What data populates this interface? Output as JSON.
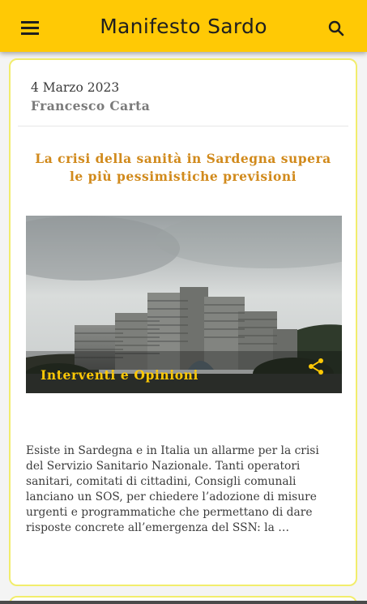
{
  "app_bar": {
    "title": "Manifesto Sardo",
    "menu_icon": "menu-icon",
    "search_icon": "search-icon",
    "background": "#ffc905"
  },
  "article": {
    "date": "4 Marzo 2023",
    "author": "Francesco Carta",
    "title": "La crisi della sanità in Sardegna supera le più pessimistiche previsioni",
    "category": "Interventi e Opinioni",
    "share_icon": "share-icon",
    "excerpt": "Esiste in Sardegna e in Italia un allarme per la crisi del Servizio Sanitario Nazionale. Tanti operatori sanitari, comitati di cittadini, Consigli comunali lanciano un SOS, per chiedere l’adozione di misure urgenti e programmatiche che permettano di dare risposte concrete all’emergenza del SSN: la …",
    "title_color": "#d18a1c",
    "category_color": "#ffc905",
    "card_border": "#f2ed6c"
  }
}
